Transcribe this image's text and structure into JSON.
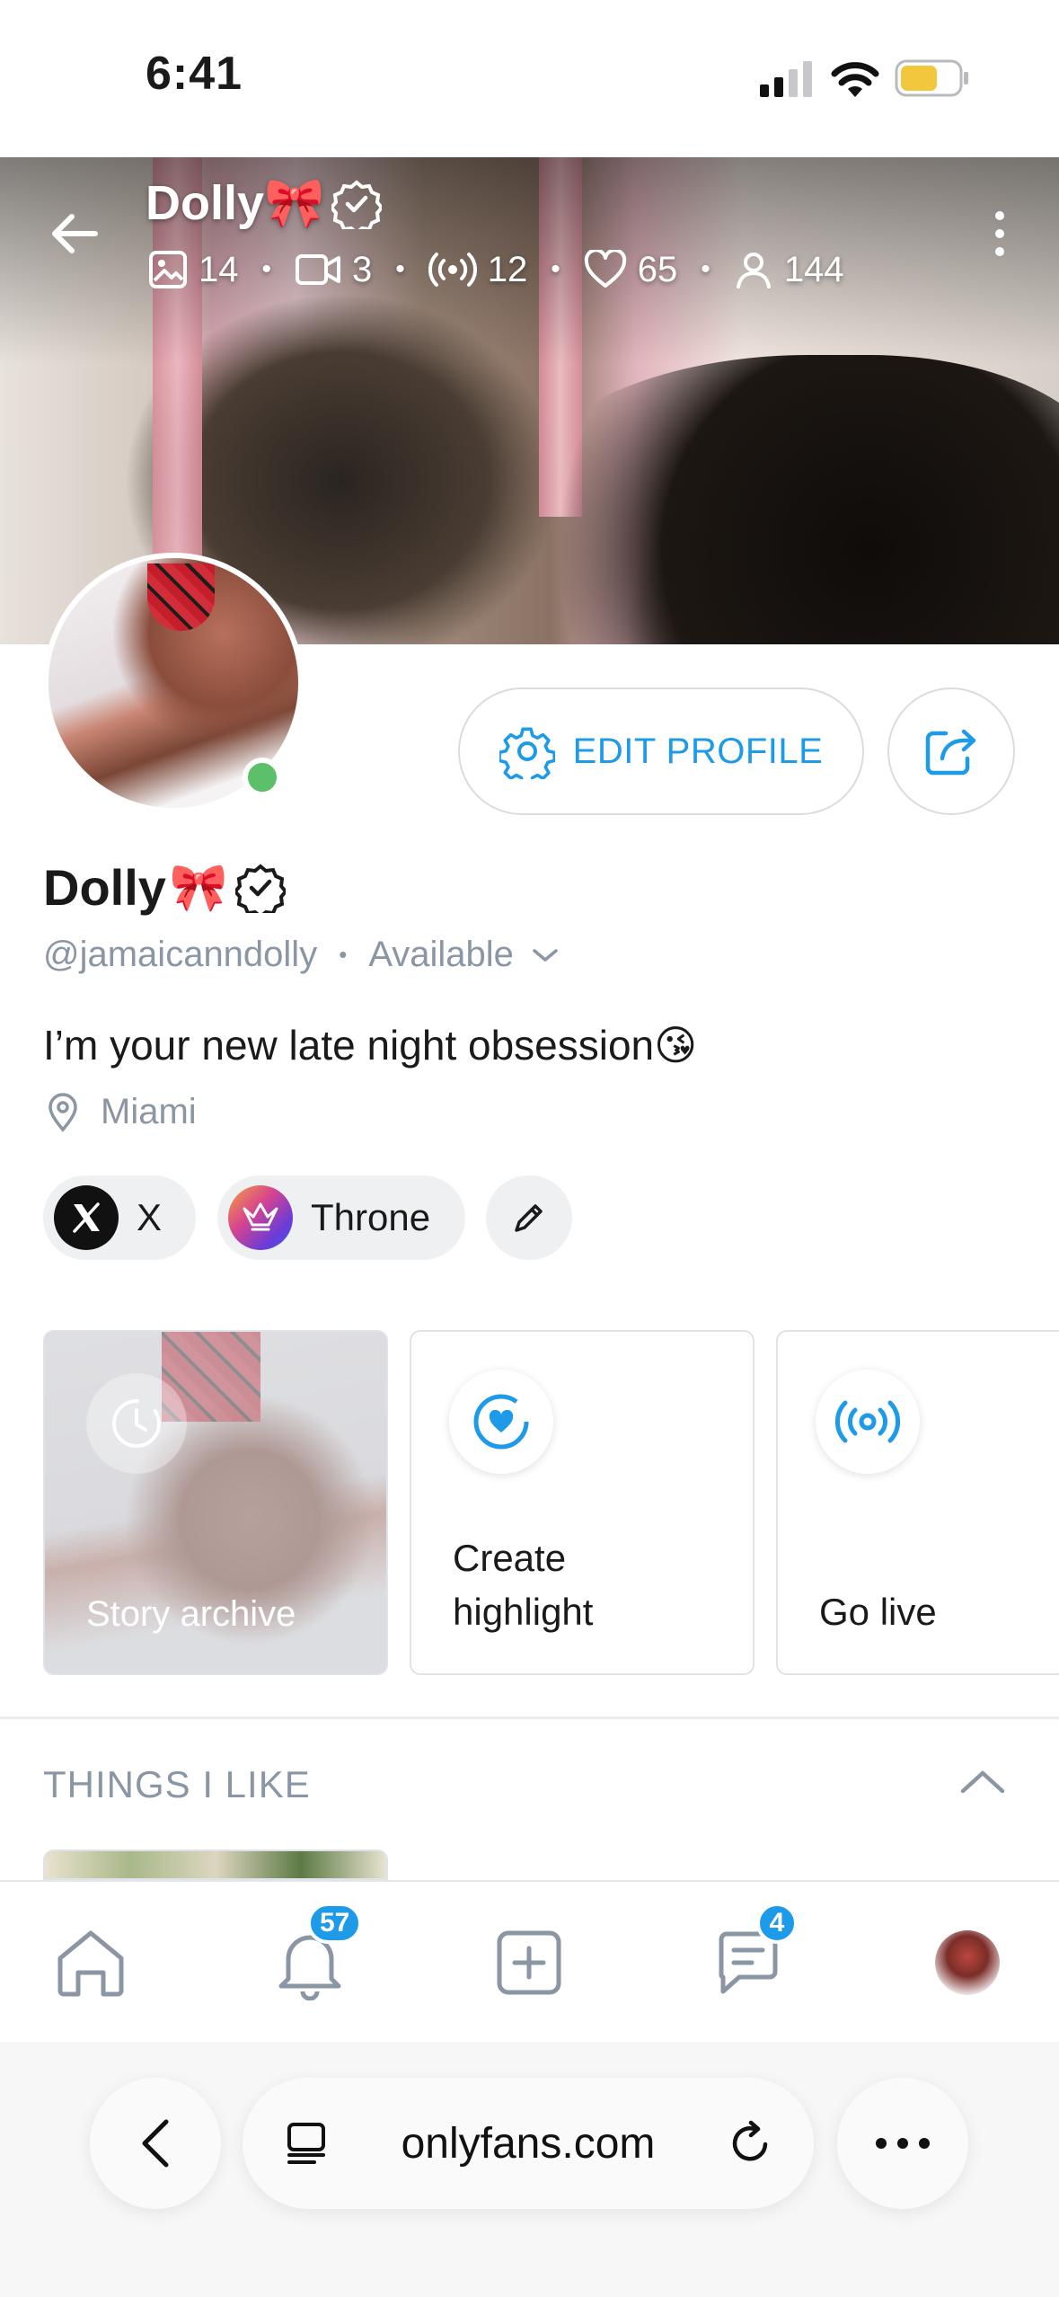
{
  "status_bar": {
    "time": "6:41"
  },
  "cover": {
    "name": "Dolly🎀",
    "stats": {
      "photos": "14",
      "videos": "3",
      "streams": "12",
      "likes": "65",
      "fans": "144"
    }
  },
  "actions": {
    "edit_profile": "EDIT PROFILE"
  },
  "profile": {
    "name": "Dolly",
    "bow": "🎀",
    "handle": "@jamaicanndolly",
    "status": "Available",
    "bio": "I’m your new late night obsession😘",
    "location": "Miami"
  },
  "links": [
    {
      "label": "X"
    },
    {
      "label": "Throne"
    }
  ],
  "highlights": {
    "archive": "Story archive",
    "create_line1": "Create",
    "create_line2": "highlight",
    "live": "Go live"
  },
  "things_i_like": {
    "title": "THINGS I LIKE"
  },
  "bottom_nav": {
    "notifications_badge": "57",
    "messages_badge": "4"
  },
  "browser": {
    "url": "onlyfans.com"
  },
  "colors": {
    "accent": "#1e9be8",
    "online": "#5cc06a",
    "muted": "#8a96a3"
  }
}
